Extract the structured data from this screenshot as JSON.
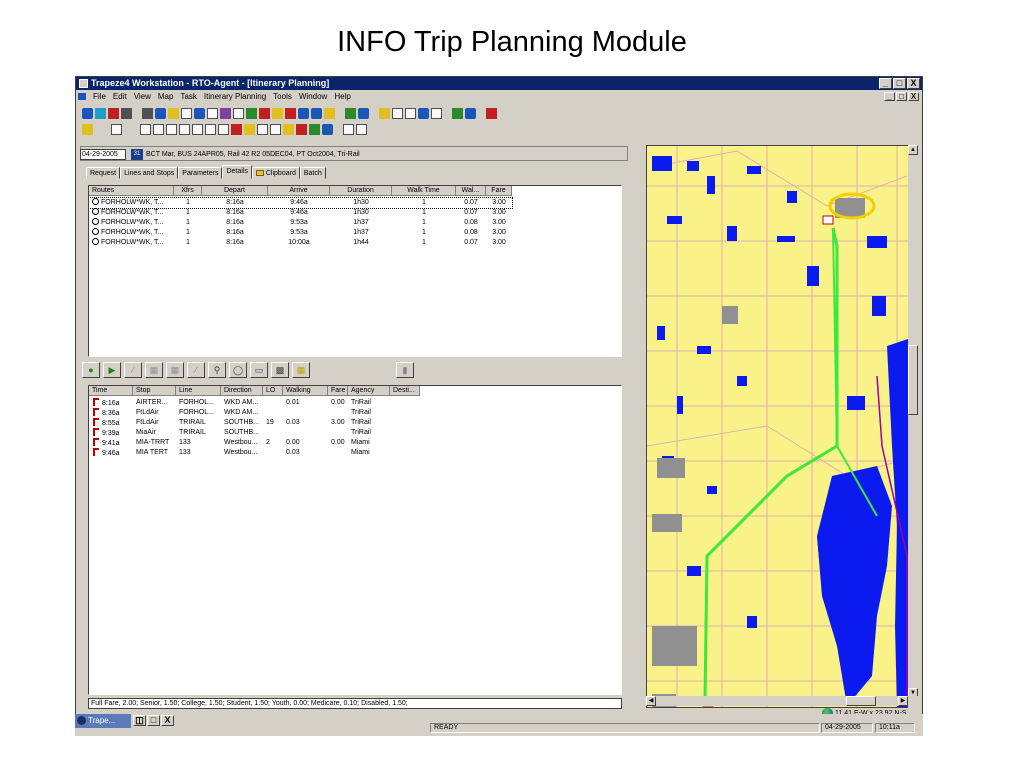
{
  "slide": {
    "title": "INFO Trip Planning Module"
  },
  "window": {
    "title": "Trapeze4 Workstation - RTO-Agent - [Itinerary Planning]",
    "controls": [
      "_",
      "□",
      "X"
    ]
  },
  "menu": [
    "File",
    "Edit",
    "View",
    "Map",
    "Task",
    "Itinerary Planning",
    "Tools",
    "Window",
    "Help"
  ],
  "toolbar_icons": [
    "globe-icon",
    "route-icon",
    "x-icon",
    "clear-icon",
    "bank-icon",
    "bus-icon",
    "edit-icon",
    "table-icon",
    "grid-icon",
    "list-icon",
    "calc-icon",
    "filter-icon",
    "search-icon",
    "people-icon",
    "stops-icon",
    "schedule-icon",
    "report-icon",
    "print-icon",
    "zoom-extents-icon",
    "zoom-in-icon",
    "zoom-out-icon",
    "measure-icon",
    "pan-icon",
    "layer-icon",
    "chart-icon",
    "help-icon"
  ],
  "info": {
    "date": "04-29-2005",
    "cal_label": "31",
    "text": "BCT Mar,  BUS 24APR05,  Rail 42 R2 05DEC04,  PT Oct2004,  Tri-Rail"
  },
  "tabs": [
    "Request",
    "Lines and Stops",
    "Parameters",
    "Details",
    "Clipboard",
    "Batch"
  ],
  "routes_table": {
    "headers": [
      "Routes",
      "Xfrs",
      "Depart",
      "Arrive",
      "Duration",
      "Walk Time",
      "Wal...",
      "Fare"
    ],
    "rows": [
      [
        "FORHOLW*WK, T...",
        "1",
        "8:16a",
        "9:46a",
        "1h30",
        "1",
        "0.07",
        "3.00"
      ],
      [
        "FORHOLW*WK, T...",
        "1",
        "8:16a",
        "9:46a",
        "1h30",
        "1",
        "0.07",
        "3.00"
      ],
      [
        "FORHOLW*WK, T...",
        "1",
        "8:16a",
        "9:53a",
        "1h37",
        "1",
        "0.08",
        "3.00"
      ],
      [
        "FORHOLW*WK, T...",
        "1",
        "8:16a",
        "9:53a",
        "1h37",
        "1",
        "0.08",
        "3.00"
      ],
      [
        "FORHOLW*WK, T...",
        "1",
        "8:16a",
        "10:00a",
        "1h44",
        "1",
        "0.07",
        "3.00"
      ]
    ]
  },
  "itinerary_table": {
    "headers": [
      "Time",
      "Stop",
      "Line",
      "Direction",
      "LO",
      "Walking",
      "Fare",
      "Agency",
      "Desti..."
    ],
    "rows": [
      [
        "8:16a",
        "AIRTER...",
        "FORHOL...",
        "WKD AM...",
        "",
        "0.01",
        "0.00",
        "TriRail",
        ""
      ],
      [
        "8:36a",
        "FtLdAir",
        "FORHOL...",
        "WKD AM...",
        "",
        "",
        "",
        "TriRail",
        ""
      ],
      [
        "8:55a",
        "FtLdAir",
        "TRIRAIL",
        "SOUTHB...",
        "19",
        "0.03",
        "3.00",
        "TriRail",
        ""
      ],
      [
        "9:39a",
        "MiaAir",
        "TRIRAIL",
        "SOUTHB...",
        "",
        "",
        "",
        "TriRail",
        ""
      ],
      [
        "9:41a",
        "MIA-TRRT",
        "133",
        "Westbou...",
        "2",
        "0.00",
        "0.00",
        "Miami",
        ""
      ],
      [
        "9:46a",
        "MIA TERT",
        "133",
        "Westbou...",
        "",
        "0.03",
        "",
        "Miami",
        ""
      ]
    ]
  },
  "fare_status": "Full Fare, 2.00; Senior, 1.50; College, 1.50; Student, 1.50; Youth, 0.00; Medicare, 0.10; Disabled, 1.50;",
  "coords": "11.41 E-W x 23.92 N-S",
  "taskbar": {
    "app_label": "Trape...",
    "status": "READY",
    "date": "04-29-2005",
    "time": "10:11a"
  },
  "colors": {
    "titlebar": "#0a246a",
    "face": "#d4d0c8",
    "map_land": "#f9f289",
    "map_water": "#0b1bf0",
    "route": "#3de83d"
  }
}
